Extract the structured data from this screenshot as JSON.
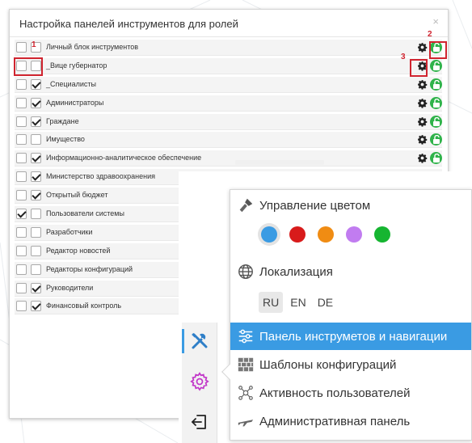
{
  "dialog": {
    "title": "Настройка панелей инструментов для ролей",
    "close_glyph": "×"
  },
  "markers": [
    "1",
    "2",
    "3"
  ],
  "roles": [
    {
      "label": "Личный блок инструментов",
      "check1": false,
      "check2": false
    },
    {
      "label": "_Вице губернатор",
      "check1": false,
      "check2": false
    },
    {
      "label": "_Специалисты",
      "check1": false,
      "check2": true
    },
    {
      "label": "Администраторы",
      "check1": false,
      "check2": true
    },
    {
      "label": "Граждане",
      "check1": false,
      "check2": true
    },
    {
      "label": "Имущество",
      "check1": false,
      "check2": false
    },
    {
      "label": "Информационно-аналитическое обеспечение",
      "check1": false,
      "check2": true
    },
    {
      "label": "Министерство здравоохранения",
      "check1": false,
      "check2": true
    },
    {
      "label": "Открытый бюджет",
      "check1": false,
      "check2": true
    },
    {
      "label": "Пользователи системы",
      "check1": true,
      "check2": false
    },
    {
      "label": "Разработчики",
      "check1": false,
      "check2": false
    },
    {
      "label": "Редактор новостей",
      "check1": false,
      "check2": false
    },
    {
      "label": "Редакторы конфигураций",
      "check1": false,
      "check2": false
    },
    {
      "label": "Руководители",
      "check1": false,
      "check2": true
    },
    {
      "label": "Финансовый контроль",
      "check1": false,
      "check2": true
    }
  ],
  "settings_menu": {
    "color_label": "Управление цветом",
    "colors": [
      "#3a9be3",
      "#d81b1b",
      "#f08c13",
      "#c17cf0",
      "#16b531"
    ],
    "selected_color": "#3a9be3",
    "localization_label": "Локализация",
    "languages": [
      "RU",
      "EN",
      "DE"
    ],
    "selected_language": "RU",
    "toolbar_nav_label": "Панель инструметов и навигации",
    "templates_label": "Шаблоны конфигураций",
    "activity_label": "Активность пользователей",
    "admin_panel_label": "Административная панель"
  },
  "icons": {
    "row_settings": "gear-icon",
    "row_access": "unlock-icon",
    "sidebar": [
      "tools-icon",
      "gear-icon",
      "exit-icon"
    ]
  }
}
